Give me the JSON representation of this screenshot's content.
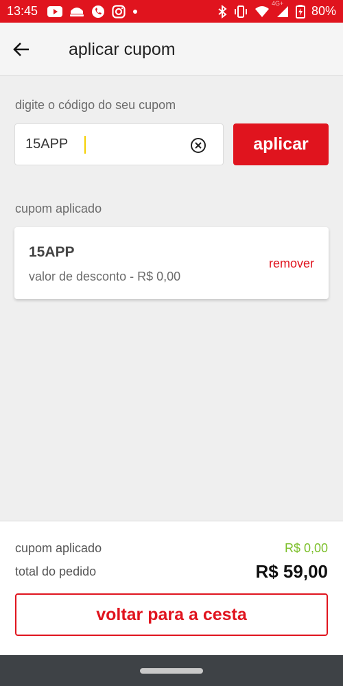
{
  "status_bar": {
    "time": "13:45",
    "network": "4G+",
    "battery": "80%",
    "color": "#e0141e"
  },
  "app_bar": {
    "title": "aplicar cupom",
    "back_icon": "arrow-left-icon"
  },
  "coupon_input": {
    "label": "digite o código do seu cupom",
    "value": "15APP",
    "clear_icon": "clear-circle-icon",
    "apply_label": "aplicar"
  },
  "applied": {
    "label": "cupom aplicado",
    "code": "15APP",
    "description": "valor de desconto - R$ 0,00",
    "remove_label": "remover"
  },
  "summary": {
    "discount_label": "cupom aplicado",
    "discount_value": "R$ 0,00",
    "total_label": "total do pedido",
    "total_value": "R$ 59,00",
    "back_button": "voltar para a cesta"
  },
  "colors": {
    "accent": "#e0141e",
    "discount_green": "#7cbf2a"
  }
}
